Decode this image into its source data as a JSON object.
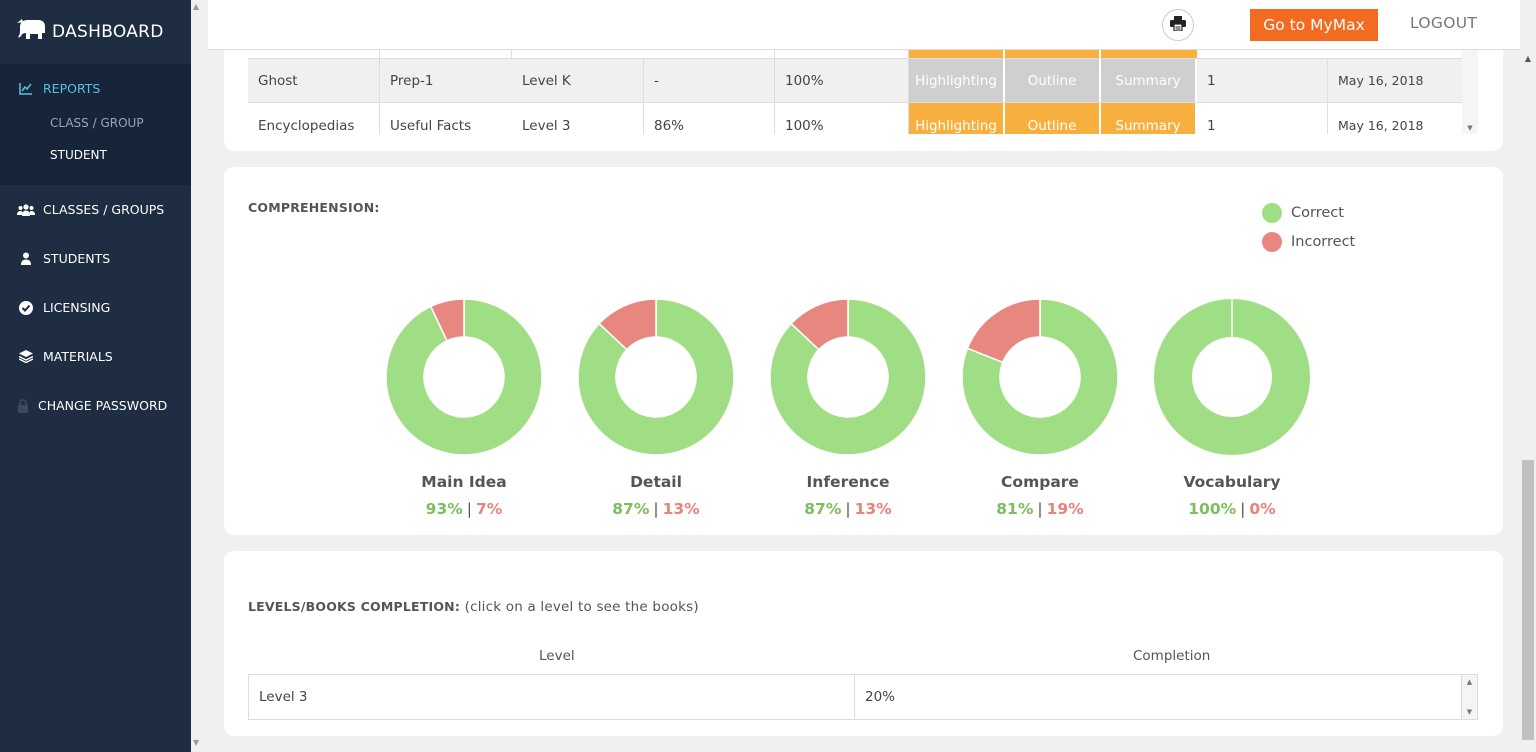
{
  "sidebar": {
    "brand": "DASHBOARD",
    "reports_label": "REPORTS",
    "sub_items": [
      {
        "label": "CLASS / GROUP"
      },
      {
        "label": "STUDENT"
      }
    ],
    "items": [
      {
        "label": "CLASSES / GROUPS",
        "icon": "users-icon"
      },
      {
        "label": "STUDENTS",
        "icon": "user-icon"
      },
      {
        "label": "LICENSING",
        "icon": "check-circle-icon"
      },
      {
        "label": "MATERIALS",
        "icon": "layers-icon"
      },
      {
        "label": "CHANGE PASSWORD",
        "icon": "lock-icon"
      }
    ]
  },
  "topbar": {
    "print_icon": "printer-icon",
    "mymax_label": "Go to MyMax",
    "logout_label": "LOGOUT"
  },
  "books_table": {
    "rows": [
      {
        "book": "Ghost",
        "series": "Prep-1",
        "level": "Level K",
        "score1": "-",
        "score2": "100%",
        "skills": [
          "Highlighting",
          "Outline",
          "Summary"
        ],
        "skill_state": "gray",
        "count": "1",
        "date": "May 16, 2018"
      },
      {
        "book": "Encyclopedias",
        "series": "Useful Facts",
        "level": "Level 3",
        "score1": "86%",
        "score2": "100%",
        "skills": [
          "Highlighting",
          "Outline",
          "Summary"
        ],
        "skill_state": "orange",
        "count": "1",
        "date": "May 16, 2018"
      }
    ]
  },
  "comprehension": {
    "title": "COMPREHENSION:",
    "legend": [
      {
        "label": "Correct",
        "color": "#a0de85"
      },
      {
        "label": "Incorrect",
        "color": "#e8877f"
      }
    ],
    "chart_data": {
      "type": "pie",
      "title": "COMPREHENSION:",
      "categories": [
        "Main Idea",
        "Detail",
        "Inference",
        "Compare",
        "Vocabulary"
      ],
      "series": [
        {
          "name": "Correct",
          "values": [
            93,
            87,
            87,
            81,
            100
          ]
        },
        {
          "name": "Incorrect",
          "values": [
            7,
            13,
            13,
            19,
            0
          ]
        }
      ]
    },
    "donuts": [
      {
        "name": "Main Idea",
        "correct": "93%",
        "incorrect": "7%"
      },
      {
        "name": "Detail",
        "correct": "87%",
        "incorrect": "13%"
      },
      {
        "name": "Inference",
        "correct": "87%",
        "incorrect": "13%"
      },
      {
        "name": "Compare",
        "correct": "81%",
        "incorrect": "19%"
      },
      {
        "name": "Vocabulary",
        "correct": "100%",
        "incorrect": "0%"
      }
    ]
  },
  "levels": {
    "title": "LEVELS/BOOKS COMPLETION:",
    "note": "(click on a level to see the books)",
    "col_level": "Level",
    "col_completion": "Completion",
    "rows": [
      {
        "level": "Level 3",
        "completion": "20%"
      }
    ]
  }
}
